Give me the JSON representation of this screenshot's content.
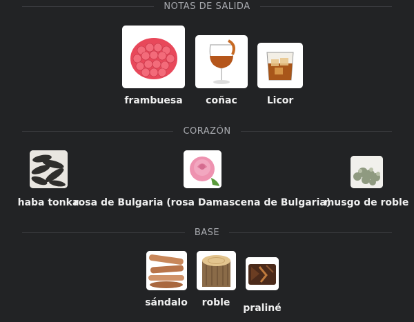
{
  "sections": {
    "top": {
      "title": "NOTAS DE SALIDA",
      "notes": [
        {
          "label": "frambuesa",
          "icon": "raspberry-icon"
        },
        {
          "label": "coñac",
          "icon": "cognac-glass-icon"
        },
        {
          "label": "Licor",
          "icon": "liquor-glass-icon"
        }
      ]
    },
    "heart": {
      "title": "CORAZÓN",
      "notes": [
        {
          "label": "haba tonka",
          "icon": "tonka-bean-icon"
        },
        {
          "label": "rosa de Bulgaria (rosa Damascena de Bulgaria)",
          "icon": "rose-icon"
        },
        {
          "label": "musgo de roble",
          "icon": "oakmoss-icon"
        }
      ]
    },
    "base": {
      "title": "BASE",
      "notes": [
        {
          "label": "sándalo",
          "icon": "sandalwood-icon"
        },
        {
          "label": "roble",
          "icon": "oak-log-icon"
        },
        {
          "label": "praliné",
          "icon": "praline-icon"
        }
      ]
    }
  }
}
